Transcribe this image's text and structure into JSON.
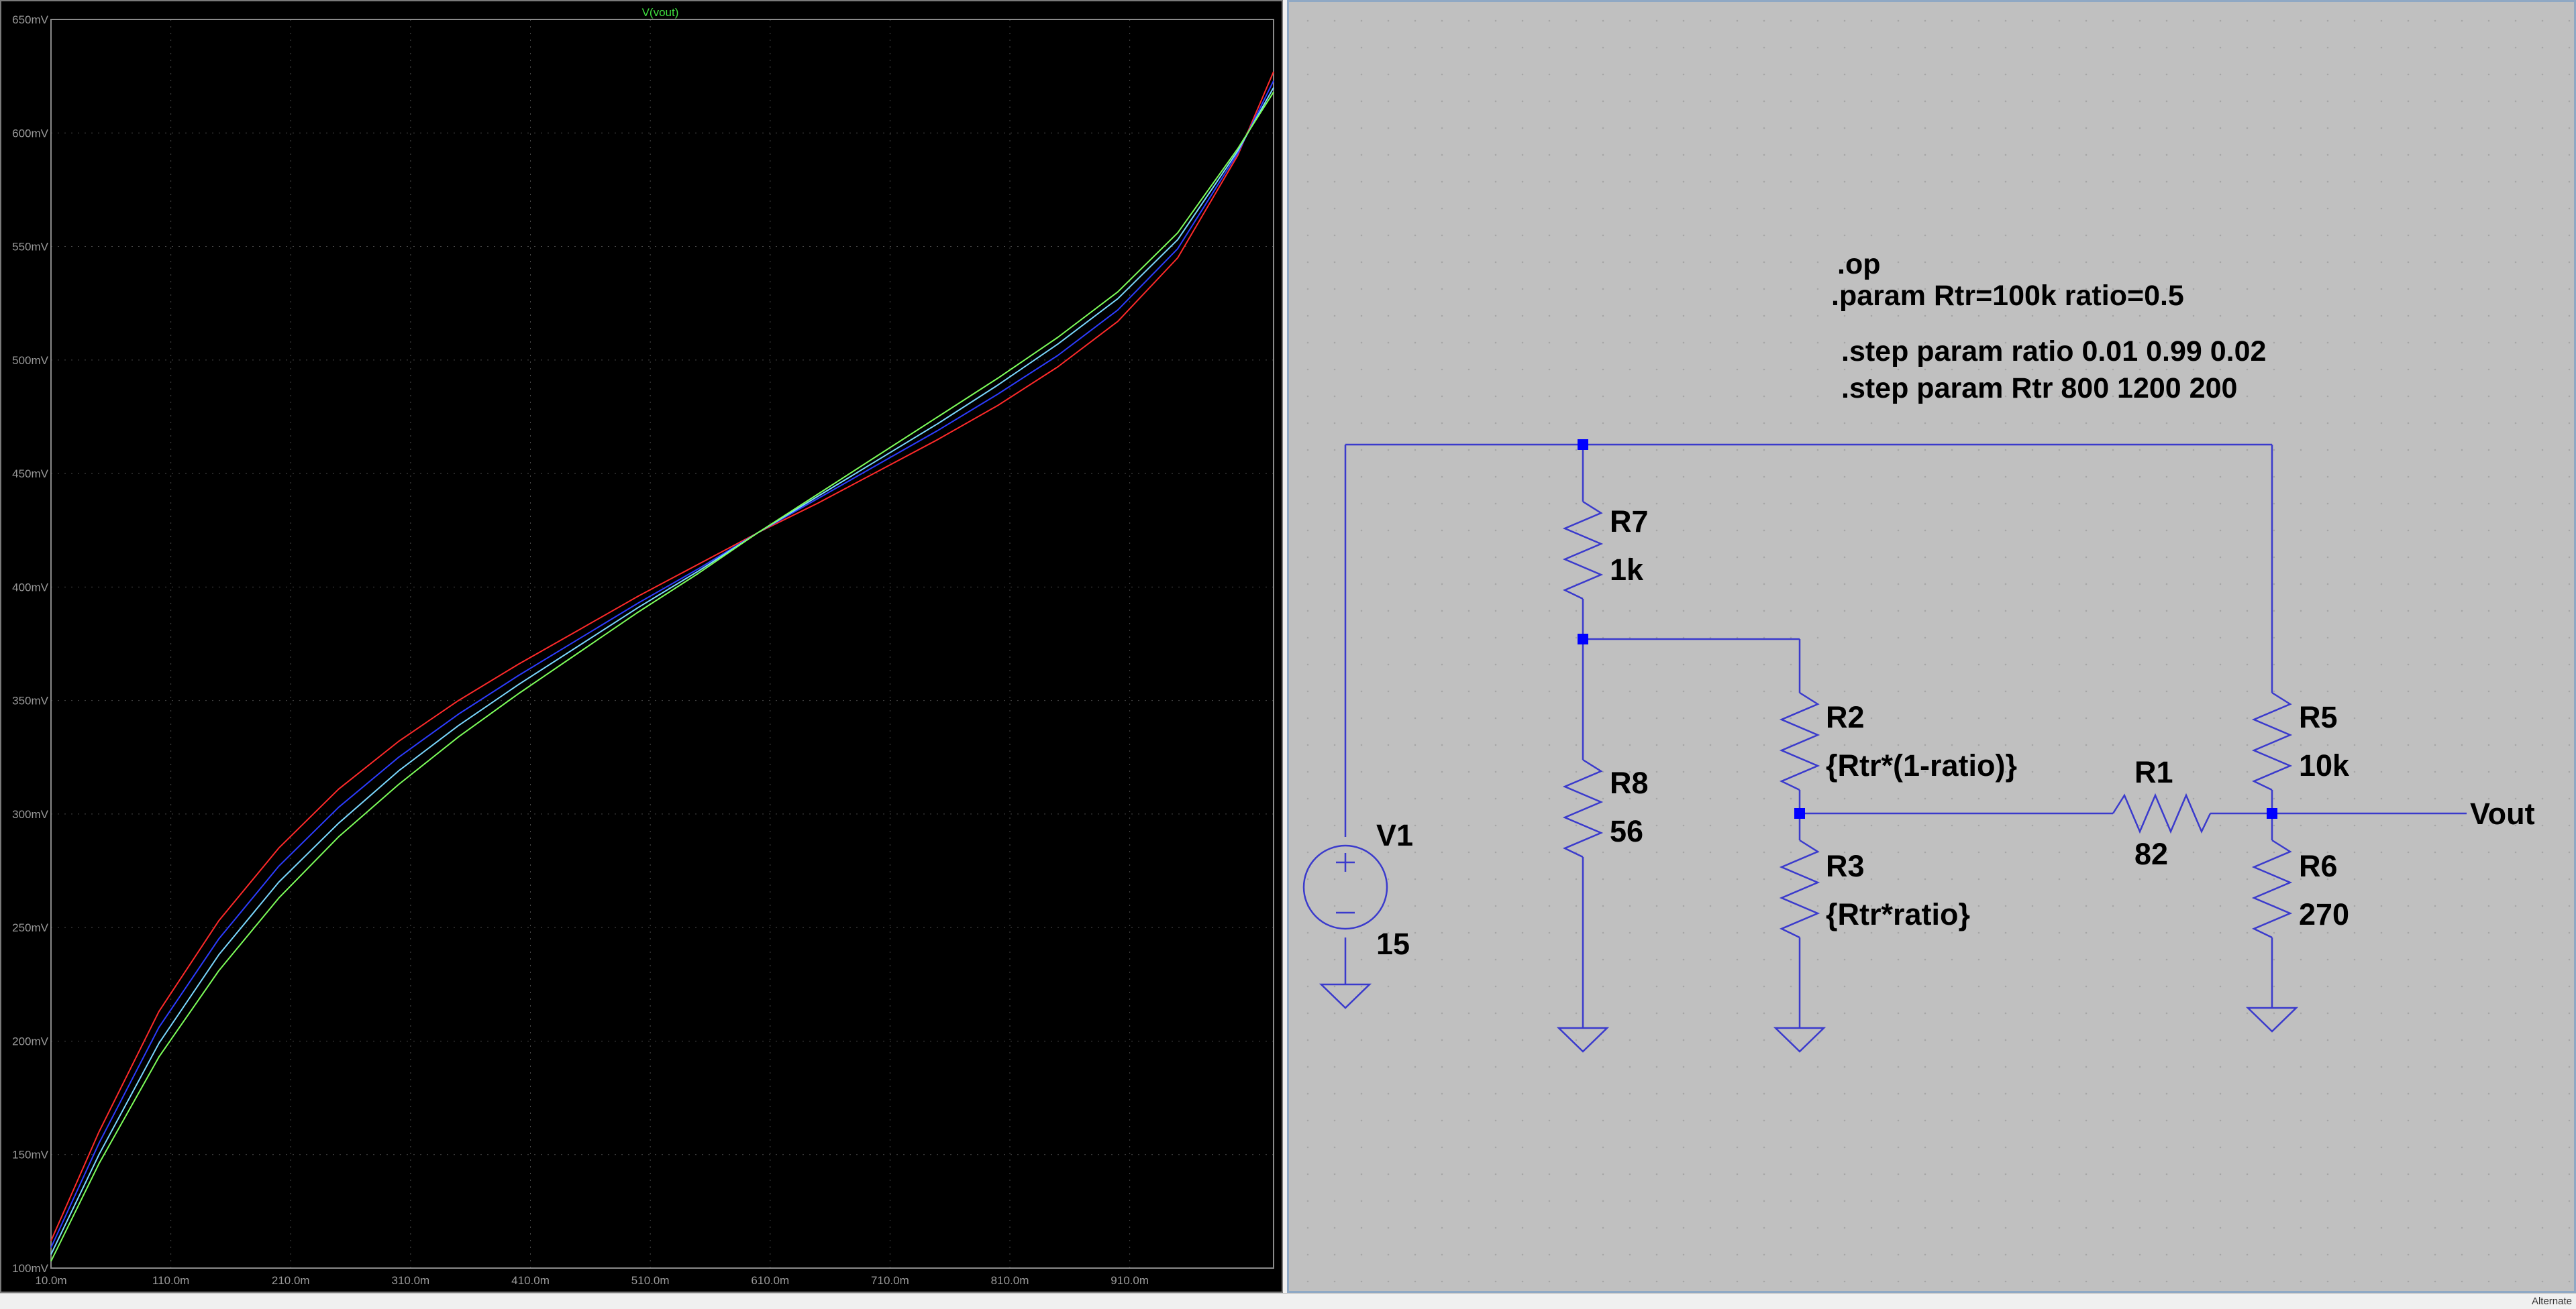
{
  "status_bar": {
    "mode": "Alternate"
  },
  "plot": {
    "trace_title": "V(vout)",
    "y_ticks": [
      "100mV",
      "150mV",
      "200mV",
      "250mV",
      "300mV",
      "350mV",
      "400mV",
      "450mV",
      "500mV",
      "550mV",
      "600mV",
      "650mV"
    ],
    "x_ticks": [
      "10.0m",
      "110.0m",
      "210.0m",
      "310.0m",
      "410.0m",
      "510.0m",
      "610.0m",
      "710.0m",
      "810.0m",
      "910.0m"
    ],
    "background": "#000000",
    "grid_color": "#4a4a4a",
    "chart_data": {
      "type": "line",
      "title": "V(vout)",
      "xlabel": "",
      "ylabel": "",
      "xlim": [
        0.01,
        1.03
      ],
      "ylim": [
        0.1,
        0.65
      ],
      "grid": true,
      "series": [
        {
          "color": "#ff2a2a",
          "x": [
            0.01,
            0.05,
            0.1,
            0.15,
            0.2,
            0.25,
            0.3,
            0.35,
            0.4,
            0.45,
            0.5,
            0.55,
            0.6,
            0.65,
            0.7,
            0.75,
            0.8,
            0.85,
            0.9,
            0.95,
            1.0,
            1.03
          ],
          "y": [
            0.112,
            0.16,
            0.213,
            0.253,
            0.285,
            0.311,
            0.332,
            0.35,
            0.366,
            0.381,
            0.396,
            0.41,
            0.424,
            0.437,
            0.451,
            0.465,
            0.48,
            0.497,
            0.517,
            0.545,
            0.59,
            0.627
          ]
        },
        {
          "color": "#2c3cff",
          "x": [
            0.01,
            0.05,
            0.1,
            0.15,
            0.2,
            0.25,
            0.3,
            0.35,
            0.4,
            0.45,
            0.5,
            0.55,
            0.6,
            0.65,
            0.7,
            0.75,
            0.8,
            0.85,
            0.9,
            0.95,
            1.0,
            1.03
          ],
          "y": [
            0.109,
            0.155,
            0.206,
            0.245,
            0.277,
            0.303,
            0.325,
            0.344,
            0.361,
            0.377,
            0.393,
            0.408,
            0.424,
            0.439,
            0.454,
            0.469,
            0.485,
            0.502,
            0.522,
            0.549,
            0.591,
            0.623
          ]
        },
        {
          "color": "#7ad8ff",
          "x": [
            0.01,
            0.05,
            0.1,
            0.15,
            0.2,
            0.25,
            0.3,
            0.35,
            0.4,
            0.45,
            0.5,
            0.55,
            0.6,
            0.65,
            0.7,
            0.75,
            0.8,
            0.85,
            0.9,
            0.95,
            1.0,
            1.03
          ],
          "y": [
            0.106,
            0.15,
            0.199,
            0.238,
            0.27,
            0.296,
            0.319,
            0.339,
            0.357,
            0.374,
            0.391,
            0.407,
            0.424,
            0.44,
            0.456,
            0.472,
            0.489,
            0.507,
            0.527,
            0.553,
            0.592,
            0.62
          ]
        },
        {
          "color": "#7dff5a",
          "x": [
            0.01,
            0.05,
            0.1,
            0.15,
            0.2,
            0.25,
            0.3,
            0.35,
            0.4,
            0.45,
            0.5,
            0.55,
            0.6,
            0.65,
            0.7,
            0.75,
            0.8,
            0.85,
            0.9,
            0.95,
            1.0,
            1.03
          ],
          "y": [
            0.103,
            0.146,
            0.193,
            0.231,
            0.263,
            0.29,
            0.313,
            0.334,
            0.353,
            0.371,
            0.389,
            0.406,
            0.424,
            0.441,
            0.458,
            0.475,
            0.492,
            0.51,
            0.53,
            0.556,
            0.593,
            0.618
          ]
        }
      ]
    }
  },
  "schematic": {
    "directives": [
      ".op",
      ".param Rtr=100k ratio=0.5",
      ".step param ratio 0.01 0.99 0.02",
      ".step param Rtr 800 1200 200"
    ],
    "components": {
      "R7": {
        "name": "R7",
        "value": "1k"
      },
      "R8": {
        "name": "R8",
        "value": "56"
      },
      "R2": {
        "name": "R2",
        "value": "{Rtr*(1-ratio)}"
      },
      "R3": {
        "name": "R3",
        "value": "{Rtr*ratio}"
      },
      "R1": {
        "name": "R1",
        "value": "82"
      },
      "R5": {
        "name": "R5",
        "value": "10k"
      },
      "R6": {
        "name": "R6",
        "value": "270"
      },
      "V1": {
        "name": "V1",
        "value": "15"
      }
    },
    "net_label": "Vout",
    "wire_color": "#3a3acc",
    "junction_color": "#0000ff"
  }
}
